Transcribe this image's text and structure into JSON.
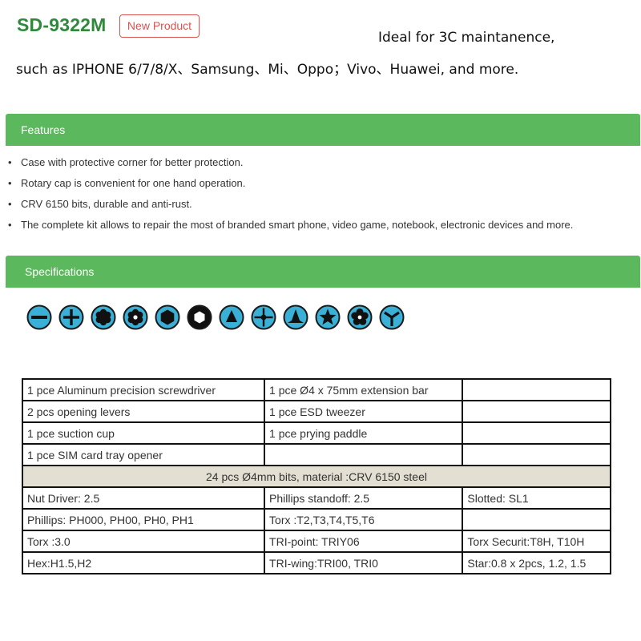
{
  "header": {
    "model": "SD-9322M",
    "badge": "New Product",
    "intro_line1": "Ideal for 3C maintanence,",
    "intro_line2": "such as IPHONE 6/7/8/X、Samsung、Mi、Oppo；Vivo、Huawei, and more."
  },
  "colors": {
    "accent_green": "#5cb85c",
    "model_green": "#2e8a3a",
    "badge_red": "#d9534f",
    "icon_blue": "#3ab0d6",
    "band_beige": "#e3e0d3"
  },
  "features": {
    "title": "Features",
    "items": [
      "Case with protective corner for better protection.",
      "Rotary cap is convenient for one hand operation.",
      "CRV 6150 bits, durable and anti-rust.",
      "The complete kit allows to repair the most of branded smart phone, video game, notebook, electronic devices and more."
    ]
  },
  "specifications": {
    "title": "Specifications",
    "bit_icons": [
      "slotted-icon",
      "phillips-icon",
      "torx-icon",
      "security-torx-icon",
      "hex-icon",
      "nut-driver-icon",
      "tri-point-icon",
      "phillips-standoff-icon",
      "tri-point-alt-icon",
      "star-icon",
      "pentalobe-icon",
      "tri-wing-icon"
    ],
    "table": {
      "rows_top": [
        [
          "1 pce Aluminum precision screwdriver",
          "1 pce Ø4 x 75mm extension bar",
          ""
        ],
        [
          "2 pcs opening levers",
          "1 pce ESD tweezer",
          ""
        ],
        [
          "1 pce suction cup",
          "1 pce prying paddle",
          ""
        ],
        [
          "1 pce SIM card tray opener",
          "",
          ""
        ]
      ],
      "band": "24 pcs Ø4mm bits, material :CRV 6150 steel",
      "rows_bottom": [
        [
          "Nut Driver: 2.5",
          "Phillips standoff: 2.5",
          "Slotted: SL1"
        ],
        [
          "Phillips: PH000, PH00, PH0, PH1",
          "Torx :T2,T3,T4,T5,T6",
          ""
        ],
        [
          "Torx :3.0",
          "TRI-point: TRIY06",
          "Torx Securit:T8H, T10H"
        ],
        [
          "Hex:H1.5,H2",
          "TRI-wing:TRI00, TRI0",
          "Star:0.8 x 2pcs, 1.2, 1.5"
        ]
      ]
    }
  }
}
